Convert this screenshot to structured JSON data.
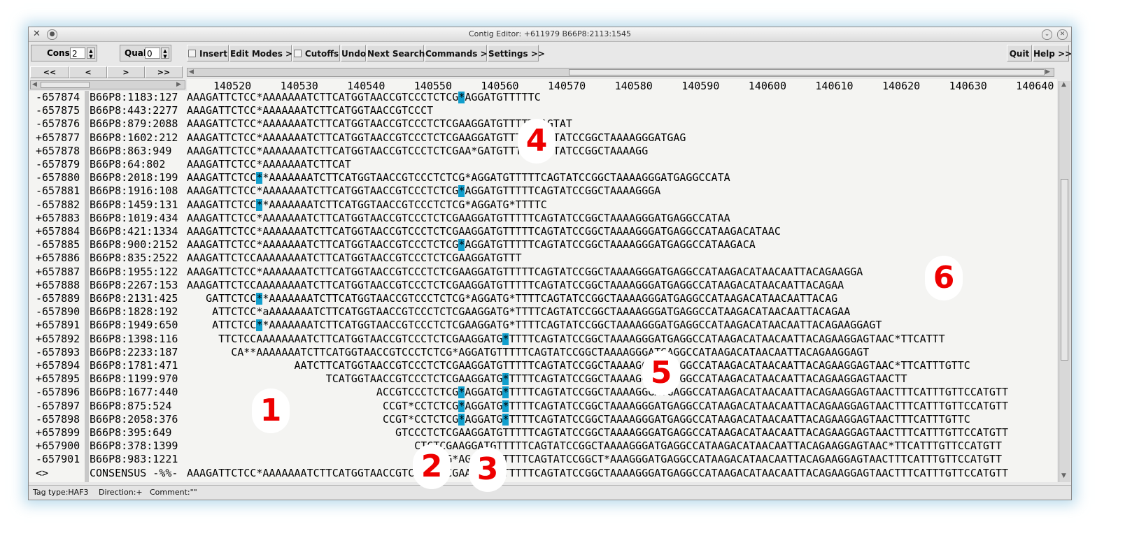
{
  "window": {
    "title": "Contig Editor: +611979 B66P8:2113:1545"
  },
  "toolbar": {
    "cons_label": "Cons",
    "cons_value": "2",
    "qual_label": "Qual",
    "qual_value": "0",
    "insert_label": "Insert",
    "edit_modes_label": "Edit Modes >>",
    "cutoffs_label": "Cutoffs",
    "undo_label": "Undo",
    "next_search_label": "Next Search",
    "commands_label": "Commands >>",
    "settings_label": "Settings >>",
    "quit_label": "Quit",
    "help_label": "Help >>"
  },
  "nav": {
    "first": "<<",
    "prev": "<",
    "next": ">",
    "last": ">>"
  },
  "ruler": [
    "140520",
    "140530",
    "140540",
    "140550",
    "140560",
    "140570",
    "140580",
    "140590",
    "140600",
    "140610",
    "140620",
    "140630",
    "140640"
  ],
  "reads": [
    {
      "num": "-657874",
      "name": "B66P8:1183:127",
      "seq": "AAAGATTCTCC*AAAAAAATCTTCATGGTAACCGTCCCTCTCG*AGGATGTTTTTC"
    },
    {
      "num": "-657875",
      "name": "B66P8:443:2277",
      "seq": "AAAGATTCTCC*AAAAAAATCTTCATGGTAACCGTCCCT"
    },
    {
      "num": "-657876",
      "name": "B66P8:879:2088",
      "seq": "AAAGATTCTCC*AAAAAAATCTTCATGGTAACCGTCCCTCTCGAAGGATGTTTTTCAGTAT"
    },
    {
      "num": "+657877",
      "name": "B66P8:1602:212",
      "seq": "AAAGATTCTCC*AAAAAAATCTTCATGGTAACCGTCCCTCTCGAAGGATGTTTTTCAGTATCCGGCTAAAAGGGATGAG"
    },
    {
      "num": "+657878",
      "name": "B66P8:863:949",
      "seq": "AAAGATTCTCC*AAAAAAATCTTCATGGTAACCGTCCCTCTCGAA*GATGTTTTTCAGTATCCGGCTAAAAGG"
    },
    {
      "num": "-657879",
      "name": "B66P8:64:802",
      "seq": "AAAGATTCTCC*AAAAAAATCTTCAT"
    },
    {
      "num": "-657880",
      "name": "B66P8:2018:199",
      "seq": "AAAGATTCTCC**AAAAAAATCTTCATGGTAACCGTCCCTCTCG*AGGATGTTTTTCAGTATCCGGCTAAAAGGGATGAGGCCATA"
    },
    {
      "num": "-657881",
      "name": "B66P8:1916:108",
      "seq": "AAAGATTCTCC*AAAAAAATCTTCATGGTAACCGTCCCTCTCG*AGGATGTTTTTCAGTATCCGGCTAAAAGGGA"
    },
    {
      "num": "-657882",
      "name": "B66P8:1459:131",
      "seq": "AAAGATTCTCC**AAAAAAATCTTCATGGTAACCGTCCCTCTCG*AGGATG*TTTTC"
    },
    {
      "num": "+657883",
      "name": "B66P8:1019:434",
      "seq": "AAAGATTCTCC*AAAAAAATCTTCATGGTAACCGTCCCTCTCGAAGGATGTTTTTCAGTATCCGGCTAAAAGGGATGAGGCCATAA"
    },
    {
      "num": "+657884",
      "name": "B66P8:421:1334",
      "seq": "AAAGATTCTCC*AAAAAAATCTTCATGGTAACCGTCCCTCTCGAAGGATGTTTTTCAGTATCCGGCTAAAAGGGATGAGGCCATAAGACATAAC"
    },
    {
      "num": "-657885",
      "name": "B66P8:900:2152",
      "seq": "AAAGATTCTCC*AAAAAAATCTTCATGGTAACCGTCCCTCTCG*AGGATGTTTTTCAGTATCCGGCTAAAAGGGATGAGGCCATAAGACA"
    },
    {
      "num": "+657886",
      "name": "B66P8:835:2522",
      "seq": "AAAGATTCTCCAAAAAAAATCTTCATGGTAACCGTCCCTCTCGAAGGATGTTT"
    },
    {
      "num": "+657887",
      "name": "B66P8:1955:122",
      "seq": "AAAGATTCTCC*AAAAAAATCTTCATGGTAACCGTCCCTCTCGAAGGATGTTTTTCAGTATCCGGCTAAAAGGGATGAGGCCATAAGACATAACAATTACAGAAGGA"
    },
    {
      "num": "+657888",
      "name": "B66P8:2267:153",
      "seq": "AAAGATTCTCCAAAAAAAATCTTCATGGTAACCGTCCCTCTCGAAGGATGTTTTTCAGTATCCGGCTAAAAGGGATGAGGCCATAAGACATAACAATTACAGAA"
    },
    {
      "num": "-657889",
      "name": "B66P8:2131:425",
      "seq": "   GATTCTCC**AAAAAAATCTTCATGGTAACCGTCCCTCTCG*AGGATG*TTTTCAGTATCCGGCTAAAAGGGATGAGGCCATAAGACATAACAATTACAG"
    },
    {
      "num": "-657890",
      "name": "B66P8:1828:192",
      "seq": "    ATTCTCC*aAAAAAAATCTTCATGGTAACCGTCCCTCTCGAAGGATG*TTTTCAGTATCCGGCTAAAAGGGATGAGGCCATAAGACATAACAATTACAGAA"
    },
    {
      "num": "+657891",
      "name": "B66P8:1949:650",
      "seq": "    ATTCTCC**AAAAAAATCTTCATGGTAACCGTCCCTCTCGAAGGATG*TTTTCAGTATCCGGCTAAAAGGGATGAGGCCATAAGACATAACAATTACAGAAGGAGT"
    },
    {
      "num": "+657892",
      "name": "B66P8:1398:116",
      "seq": "     TTCTCCAAAAAAAATCTTCATGGTAACCGTCCCTCTCGAAGGATG*TTTTCAGTATCCGGCTAAAAGGGATGAGGCCATAAGACATAACAATTACAGAAGGAGTAAC*TTCATTT"
    },
    {
      "num": "-657893",
      "name": "B66P8:2233:187",
      "seq": "       CA**AAAAAAATCTTCATGGTAACCGTCCCTCTCG*AGGATGTTTTTCAGTATCCGGCTAAAAGGGATGAGGCCATAAGACATAACAATTACAGAAGGAGT"
    },
    {
      "num": "+657894",
      "name": "B66P8:1781:471",
      "seq": "                 AATCTTCATGGTAACCGTCCCTCTCGAAGGATGTTTTTCAGTATCCGGCTAAAAGGGATGAGGCCATAAGACATAACAATTACAGAAGGAGTAAC*TTCATTTGTTC"
    },
    {
      "num": "+657895",
      "name": "B66P8:1199:970",
      "seq": "                      TCATGGTAACCGTCCCTCTCGAAGGATG*TTTTCAGTATCCGGCTAAAAGGGATGAGGCCATAAGACATAACAATTACAGAAGGAGTAACTT"
    },
    {
      "num": "-657896",
      "name": "B66P8:1677:440",
      "seq": "                              ACCGTCCCTCTCG*AGGATG*TTTTCAGTATCCGGCTAAAAGGGATGAGGCCATAAGACATAACAATTACAGAAGGAGTAACTTTCATTTGTTCCATGTT"
    },
    {
      "num": "-657897",
      "name": "B66P8:875:524",
      "seq": "                               CCGT*CCTCTCG*AGGATG*TTTTCAGTATCCGGCTAAAAGGGATGAGGCCATAAGACATAACAATTACAGAAGGAGTAACTTTCATTTGTTCCATGTT"
    },
    {
      "num": "-657898",
      "name": "B66P8:2058:376",
      "seq": "                               CCGT*CCTCTCG*AGGATG*TTTTCAGTATCCGGCTAAAAGGGATGAGGCCATAAGACATAACAATTACAGAAGGAGTAACTTTCATTTGTTC"
    },
    {
      "num": "+657899",
      "name": "B66P8:395:649",
      "seq": "                                 GTCCCTCTCGAAGGATGTTTTTCAGTATCCGGCTAAAAGGGATGAGGCCATAAGACATAACAATTACAGAAGGAGTAACTTTCATTTGTTCCATGTT"
    },
    {
      "num": "+657900",
      "name": "B66P8:378:1399",
      "seq": "                                    CTCTCGAAGGATGTTTTTCAGTATCCGGCTAAAAGGGATGAGGCCATAAGACATAACAATTACAGAAGGAGTAAC*TTCATTTGTTCCATGTT"
    },
    {
      "num": "-657901",
      "name": "B66P8:983:1221",
      "seq": "                                    CTCTCG*AGGATG*TTTTCAGTATCCGGCT*AAAGGGATGAGGCCATAAGACATAACAATTACAGAAGGAGTAACTTTCATTTGTTCCATGTT"
    }
  ],
  "consensus": {
    "num": "<>",
    "name": "CONSENSUS -%%-",
    "seq": "AAAGATTCTCC*AAAAAAATCTTCATGGTAACCGTCCCTCTCGAAGGATGTTTTTCAGTATCCGGCTAAAAGGGATGAGGCCATAAGACATAACAATTACAGAAGGAGTAACTTTCATTTGTTCCATGTT"
  },
  "status": {
    "tag_type": "Tag type:HAF3",
    "direction": "Direction:+",
    "comment": "Comment:\"\""
  },
  "markers": [
    "1",
    "2",
    "3",
    "4",
    "5",
    "6"
  ],
  "colors": {
    "highlight": "#11a6d8",
    "marker": "#ee0000"
  }
}
